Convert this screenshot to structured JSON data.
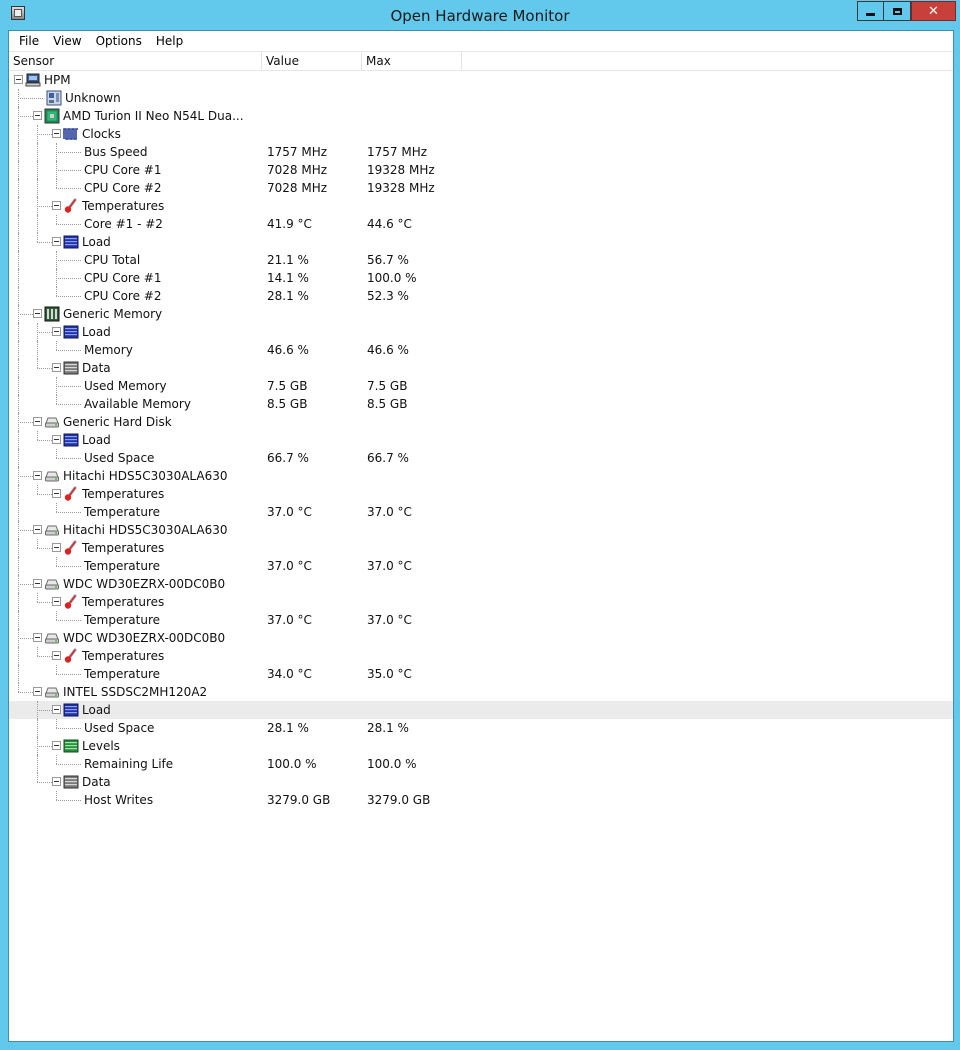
{
  "window": {
    "title": "Open Hardware Monitor"
  },
  "menu": [
    "File",
    "View",
    "Options",
    "Help"
  ],
  "columns": {
    "sensor": "Sensor",
    "value": "Value",
    "max": "Max"
  },
  "rows": [
    {
      "level": 0,
      "type": "node",
      "icon": "computer-icon",
      "label": "HPM"
    },
    {
      "level": 1,
      "type": "leaf",
      "icon": "mainboard-icon",
      "label": "Unknown"
    },
    {
      "level": 1,
      "type": "node",
      "icon": "cpu-icon",
      "label": "AMD Turion II Neo N54L Dua..."
    },
    {
      "level": 2,
      "type": "node",
      "icon": "clock-icon",
      "label": "Clocks"
    },
    {
      "level": 3,
      "type": "leaf",
      "label": "Bus Speed",
      "value": "1757 MHz",
      "max": "1757 MHz"
    },
    {
      "level": 3,
      "type": "leaf",
      "label": "CPU Core #1",
      "value": "7028 MHz",
      "max": "19328 MHz"
    },
    {
      "level": 3,
      "type": "leaf",
      "label": "CPU Core #2",
      "value": "7028 MHz",
      "max": "19328 MHz"
    },
    {
      "level": 2,
      "type": "node",
      "icon": "thermometer-icon",
      "label": "Temperatures"
    },
    {
      "level": 3,
      "type": "leaf",
      "label": "Core #1 - #2",
      "value": "41.9 °C",
      "max": "44.6 °C"
    },
    {
      "level": 2,
      "type": "node",
      "icon": "load-icon",
      "label": "Load"
    },
    {
      "level": 3,
      "type": "leaf",
      "label": "CPU Total",
      "value": "21.1 %",
      "max": "56.7 %"
    },
    {
      "level": 3,
      "type": "leaf",
      "label": "CPU Core #1",
      "value": "14.1 %",
      "max": "100.0 %"
    },
    {
      "level": 3,
      "type": "leaf",
      "label": "CPU Core #2",
      "value": "28.1 %",
      "max": "52.3 %"
    },
    {
      "level": 1,
      "type": "node",
      "icon": "ram-icon",
      "label": "Generic Memory"
    },
    {
      "level": 2,
      "type": "node",
      "icon": "load-icon",
      "label": "Load"
    },
    {
      "level": 3,
      "type": "leaf",
      "label": "Memory",
      "value": "46.6 %",
      "max": "46.6 %"
    },
    {
      "level": 2,
      "type": "node",
      "icon": "data-icon",
      "label": "Data"
    },
    {
      "level": 3,
      "type": "leaf",
      "label": "Used Memory",
      "value": "7.5 GB",
      "max": "7.5 GB"
    },
    {
      "level": 3,
      "type": "leaf",
      "label": "Available Memory",
      "value": "8.5 GB",
      "max": "8.5 GB"
    },
    {
      "level": 1,
      "type": "node",
      "icon": "hdd-icon",
      "label": "Generic Hard Disk"
    },
    {
      "level": 2,
      "type": "node",
      "icon": "load-icon",
      "label": "Load"
    },
    {
      "level": 3,
      "type": "leaf",
      "label": "Used Space",
      "value": "66.7 %",
      "max": "66.7 %"
    },
    {
      "level": 1,
      "type": "node",
      "icon": "hdd-icon",
      "label": "Hitachi HDS5C3030ALA630"
    },
    {
      "level": 2,
      "type": "node",
      "icon": "thermometer-icon",
      "label": "Temperatures"
    },
    {
      "level": 3,
      "type": "leaf",
      "label": "Temperature",
      "value": "37.0 °C",
      "max": "37.0 °C"
    },
    {
      "level": 1,
      "type": "node",
      "icon": "hdd-icon",
      "label": "Hitachi HDS5C3030ALA630"
    },
    {
      "level": 2,
      "type": "node",
      "icon": "thermometer-icon",
      "label": "Temperatures"
    },
    {
      "level": 3,
      "type": "leaf",
      "label": "Temperature",
      "value": "37.0 °C",
      "max": "37.0 °C"
    },
    {
      "level": 1,
      "type": "node",
      "icon": "hdd-icon",
      "label": "WDC WD30EZRX-00DC0B0"
    },
    {
      "level": 2,
      "type": "node",
      "icon": "thermometer-icon",
      "label": "Temperatures"
    },
    {
      "level": 3,
      "type": "leaf",
      "label": "Temperature",
      "value": "37.0 °C",
      "max": "37.0 °C"
    },
    {
      "level": 1,
      "type": "node",
      "icon": "hdd-icon",
      "label": "WDC WD30EZRX-00DC0B0"
    },
    {
      "level": 2,
      "type": "node",
      "icon": "thermometer-icon",
      "label": "Temperatures"
    },
    {
      "level": 3,
      "type": "leaf",
      "label": "Temperature",
      "value": "34.0 °C",
      "max": "35.0 °C"
    },
    {
      "level": 1,
      "type": "node",
      "icon": "hdd-icon",
      "label": "INTEL SSDSC2MH120A2"
    },
    {
      "level": 2,
      "type": "node",
      "icon": "load-icon",
      "label": "Load",
      "selected": true
    },
    {
      "level": 3,
      "type": "leaf",
      "label": "Used Space",
      "value": "28.1 %",
      "max": "28.1 %"
    },
    {
      "level": 2,
      "type": "node",
      "icon": "levels-icon",
      "label": "Levels"
    },
    {
      "level": 3,
      "type": "leaf",
      "label": "Remaining Life",
      "value": "100.0 %",
      "max": "100.0 %"
    },
    {
      "level": 2,
      "type": "node",
      "icon": "data-icon",
      "label": "Data"
    },
    {
      "level": 3,
      "type": "leaf",
      "label": "Host Writes",
      "value": "3279.0 GB",
      "max": "3279.0 GB"
    }
  ]
}
